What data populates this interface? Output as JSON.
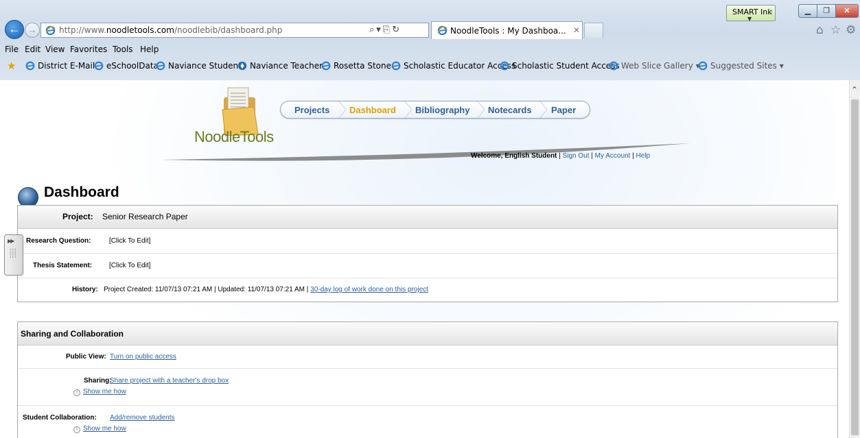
{
  "browser": {
    "smart_ink_label": "SMART Ink",
    "url_prefix": "http://www.",
    "url_domain": "noodletools.com",
    "url_path": "/noodlebib/dashboard.php",
    "tab_title": "NoodleTools : My Dashboa...",
    "menu": [
      "File",
      "Edit",
      "View",
      "Favorites",
      "Tools",
      "Help"
    ],
    "favorites": [
      {
        "label": "District E-Mail",
        "icon": "ie-icon"
      },
      {
        "label": "eSchoolData",
        "icon": "ie-icon"
      },
      {
        "label": "Naviance Student",
        "icon": "ie-icon"
      },
      {
        "label": "Naviance Teacher",
        "icon": "naviance-icon"
      },
      {
        "label": "Rosetta Stone",
        "icon": "ie-icon"
      },
      {
        "label": "Scholastic Educator Access",
        "icon": "ie-icon"
      },
      {
        "label": "Scholastic Student Access",
        "icon": "ie-icon"
      },
      {
        "label": "Web Slice Gallery ▾",
        "icon": "ie-icon"
      },
      {
        "label": "Suggested Sites ▾",
        "icon": "ie-icon"
      }
    ]
  },
  "site": {
    "logo_text": "NoodleTools",
    "nav": [
      "Projects",
      "Dashboard",
      "Bibliography",
      "Notecards",
      "Paper"
    ],
    "nav_active_index": 1,
    "welcome_text": "Welcome, English Student",
    "sign_out": "Sign Out",
    "my_account": "My Account",
    "help": "Help",
    "separator": "|"
  },
  "dashboard": {
    "title": "Dashboard",
    "project_label": "Project:",
    "project_name": "Senior Research Paper",
    "research_question_label": "Research Question:",
    "research_question_value": "[Click To Edit]",
    "thesis_label": "Thesis Statement:",
    "thesis_value": "[Click To Edit]",
    "history_label": "History:",
    "history_text": "Project Created: 11/07/13 07:21 AM | Updated: 11/07/13 07:21 AM |",
    "history_link": "30-day log of work done on this project"
  },
  "sharing": {
    "heading": "Sharing and Collaboration",
    "public_view_label": "Public View:",
    "public_view_link": "Turn on public access",
    "sharing_label": "Sharing:",
    "sharing_link": "Share project with a teacher's drop box",
    "show_me_how": "Show me how",
    "collab_label": "Student Collaboration:",
    "collab_link": "Add/remove students"
  },
  "colors": {
    "link": "#2c5f9e",
    "nav_active": "#e3a000",
    "logo_green": "#6a7a1e"
  }
}
